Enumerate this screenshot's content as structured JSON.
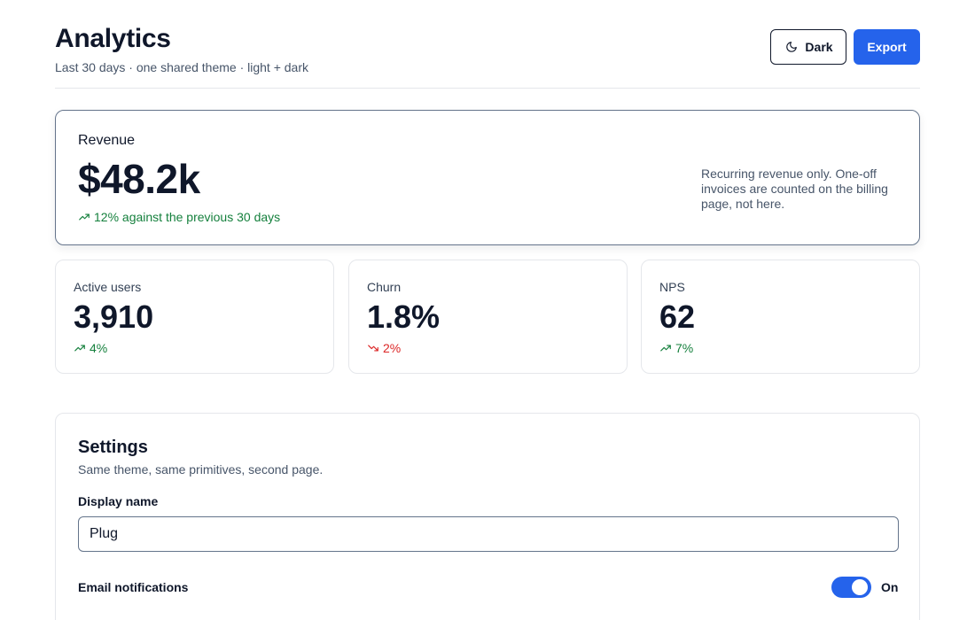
{
  "header": {
    "title": "Analytics",
    "subtitle": "Last 30 days · one shared theme · light + dark",
    "dark_button": {
      "label": "Dark",
      "icon": "moon-icon"
    },
    "export_button": {
      "label": "Export"
    }
  },
  "revenue": {
    "label": "Revenue",
    "value": "$48.2k",
    "trend": {
      "direction": "up",
      "icon": "trend-up-icon",
      "text": "12% against the previous 30 days"
    },
    "note": "Recurring revenue only. One-off invoices are counted on the billing page, not here."
  },
  "stats": [
    {
      "label": "Active users",
      "value": "3,910",
      "trend": {
        "direction": "up",
        "icon": "trend-up-icon",
        "text": "4%"
      }
    },
    {
      "label": "Churn",
      "value": "1.8%",
      "trend": {
        "direction": "down",
        "icon": "trend-down-icon",
        "text": "2%"
      }
    },
    {
      "label": "NPS",
      "value": "62",
      "trend": {
        "direction": "up",
        "icon": "trend-up-icon",
        "text": "7%"
      }
    }
  ],
  "settings": {
    "title": "Settings",
    "subtitle": "Same theme, same primitives, second page.",
    "display_name": {
      "label": "Display name",
      "value": "Plug"
    },
    "email_notifications": {
      "label": "Email notifications",
      "enabled": true,
      "state_label": "On"
    }
  },
  "colors": {
    "accent": "#2563eb",
    "positive": "#15803d",
    "negative": "#dc2626",
    "text": "#0f172a",
    "muted": "#475569"
  }
}
